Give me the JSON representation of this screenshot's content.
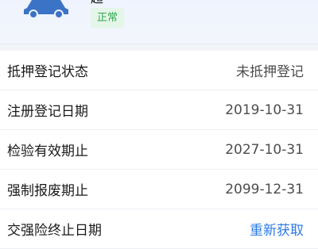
{
  "vehicle": {
    "plate_tail": "超",
    "status": "正常",
    "colors": {
      "car_icon": "#3b73c6",
      "status_bg": "#e4f6e8",
      "status_text": "#2fa84f",
      "link": "#2d7be5"
    }
  },
  "details": [
    {
      "label": "抵押登记状态",
      "value": "未抵押登记"
    },
    {
      "label": "注册登记日期",
      "value": "2019-10-31"
    },
    {
      "label": "检验有效期止",
      "value": "2027-10-31"
    },
    {
      "label": "强制报废期止",
      "value": "2099-12-31"
    },
    {
      "label": "交强险终止日期",
      "value": "重新获取"
    }
  ]
}
